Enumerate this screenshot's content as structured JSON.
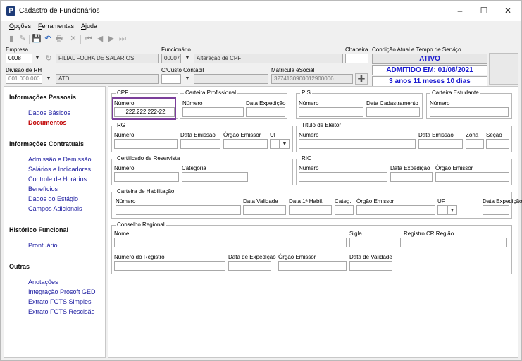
{
  "window": {
    "title": "Cadastro de Funcionários",
    "icon_letter": "P",
    "minimize": "–",
    "maximize": "☐",
    "close": "✕"
  },
  "menu": {
    "opcoes_u": "O",
    "opcoes_rest": "pções",
    "ferramentas_u": "F",
    "ferramentas_rest": "erramentas",
    "ajuda_u": "A",
    "ajuda_rest": "juda"
  },
  "toolbar": {
    "new": "▮",
    "edit": "✎",
    "save": "💾",
    "undo": "↶",
    "print": "🖶",
    "delete": "✕",
    "first": "⏮",
    "prev": "◀",
    "next": "▶",
    "last": "⏭"
  },
  "header": {
    "empresa_label": "Empresa",
    "empresa_code": "0008",
    "empresa_name": "FILIAL FOLHA DE SALARIOS",
    "funcionario_label": "Funcionário",
    "funcionario_code": "00007",
    "funcionario_name": "Alteração de CPF",
    "chapeira_label": "Chapeira",
    "chapeira_value": "",
    "divisao_label": "Divisão de RH",
    "divisao_code": "001.000.000",
    "divisao_name": "ATD",
    "ccusto_label": "C/Custo Contábil",
    "ccusto_value": "",
    "matricula_label": "Matrícula eSocial",
    "matricula_value": "3274130900012900006",
    "condicao_label": "Condição Atual e Tempo de Serviço",
    "status_ativo": "ATIVO",
    "status_admitido": "ADMITIDO EM: 01/08/2021",
    "status_tempo": "3 anos 11 meses 10 dias"
  },
  "sidebar": {
    "pessoais_title": "Informações Pessoais",
    "dados_basicos": "Dados Básicos",
    "documentos": "Documentos",
    "contratuais_title": "Informações Contratuais",
    "admissao": "Admissão e Demissão",
    "salarios": "Salários e Indicadores",
    "horarios": "Controle de Horários",
    "beneficios": "Benefícios",
    "estagio": "Dados do Estágio",
    "adicionais": "Campos Adicionais",
    "historico_title": "Histórico Funcional",
    "prontuario": "Prontuário",
    "outras_title": "Outras",
    "anotacoes": "Anotações",
    "ged": "Integração Prosoft GED",
    "fgts_simples": "Extrato FGTS Simples",
    "fgts_rescisao": "Extrato FGTS Rescisão"
  },
  "docs": {
    "cpf_title": "CPF",
    "cpf_numero_label": "Número",
    "cpf_numero": "222.222.222-22",
    "ctps_title": "Carteira Profissional",
    "ctps_numero_label": "Número",
    "ctps_data_label": "Data Expedição",
    "pis_title": "PIS",
    "pis_numero_label": "Número",
    "pis_data_label": "Data Cadastramento",
    "estudante_title": "Carteira Estudante",
    "estudante_numero_label": "Número",
    "rg_title": "RG",
    "rg_numero_label": "Número",
    "rg_data_label": "Data Emissão",
    "rg_orgao_label": "Órgão Emissor",
    "rg_uf_label": "UF",
    "titulo_title": "Título de Eleitor",
    "titulo_numero_label": "Número",
    "titulo_data_label": "Data Emissão",
    "titulo_zona_label": "Zona",
    "titulo_secao_label": "Seção",
    "reservista_title": "Certificado de Reservista",
    "reservista_numero_label": "Número",
    "reservista_categoria_label": "Categoria",
    "ric_title": "RIC",
    "ric_numero_label": "Número",
    "ric_data_label": "Data Expedição",
    "ric_orgao_label": "Órgão Emissor",
    "cnh_title": "Carteira de Habilitação",
    "cnh_numero_label": "Número",
    "cnh_validade_label": "Data Validade",
    "cnh_habil_label": "Data 1ª Habil.",
    "cnh_categ_label": "Categ.",
    "cnh_orgao_label": "Órgão Emissor",
    "cnh_uf_label": "UF",
    "cnh_exped_label": "Data Expedição",
    "conselho_title": "Conselho Regional",
    "conselho_nome_label": "Nome",
    "conselho_sigla_label": "Sigla",
    "conselho_regiao_label": "Registro CR Região",
    "conselho_registro_label": "Número do Registro",
    "conselho_exped_label": "Data de Expedição",
    "conselho_orgao_label": "Órgão Emissor",
    "conselho_validade_label": "Data de Validade"
  }
}
